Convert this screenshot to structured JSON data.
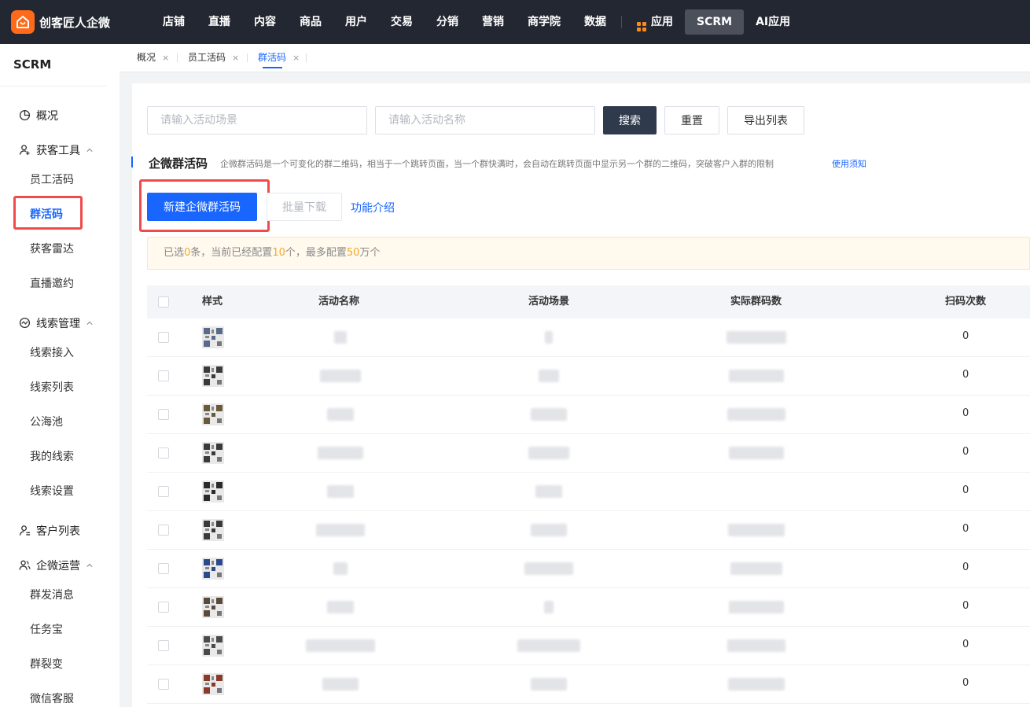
{
  "brand": {
    "name": "创客匠人企微"
  },
  "topnav": {
    "items": [
      "店铺",
      "直播",
      "内容",
      "商品",
      "用户",
      "交易",
      "分销",
      "营销",
      "商学院",
      "数据"
    ],
    "apps_label": "应用",
    "scrm_label": "SCRM",
    "ai_label": "AI应用"
  },
  "sidebar": {
    "title": "SCRM",
    "overview": "概况",
    "group_acquire": "获客工具",
    "acquire_items": [
      "员工活码",
      "群活码",
      "获客雷达",
      "直播邀约"
    ],
    "group_leads": "线索管理",
    "lead_items": [
      "线索接入",
      "线索列表",
      "公海池",
      "我的线索",
      "线索设置"
    ],
    "customer_list": "客户列表",
    "group_ops": "企微运营",
    "ops_items": [
      "群发消息",
      "任务宝",
      "群裂变",
      "微信客服"
    ]
  },
  "tabs": [
    {
      "label": "概况",
      "close": "×"
    },
    {
      "label": "员工活码",
      "close": "×"
    },
    {
      "label": "群活码",
      "close": "×"
    }
  ],
  "filters": {
    "scene_placeholder": "请输入活动场景",
    "name_placeholder": "请输入活动名称",
    "search_label": "搜索",
    "reset_label": "重置",
    "export_label": "导出列表"
  },
  "section": {
    "title": "企微群活码",
    "description": "企微群活码是一个可变化的群二维码，相当于一个跳转页面，当一个群快满时，会自动在跳转页面中显示另一个群的二维码，突破客户入群的限制",
    "help_link": "使用须知"
  },
  "actions": {
    "create_label": "新建企微群活码",
    "batch_download_label": "批量下载",
    "feature_intro_label": "功能介绍"
  },
  "notice": {
    "prefix": "已选",
    "selected": "0",
    "mid": "条，当前已经配置",
    "configured": "10",
    "mid2": "个，最多配置",
    "max": "50",
    "suffix": "万个"
  },
  "table": {
    "headers": [
      "样式",
      "活动名称",
      "活动场景",
      "实际群码数",
      "扫码次数"
    ],
    "scan_counts": [
      "0",
      "0",
      "0",
      "0",
      "0",
      "0",
      "0",
      "0",
      "0",
      "0"
    ]
  },
  "colors": {
    "primary": "#1966ff",
    "topbar": "#232731",
    "highlight": "#ef4b4b",
    "warning_text": "#f0a92b"
  }
}
